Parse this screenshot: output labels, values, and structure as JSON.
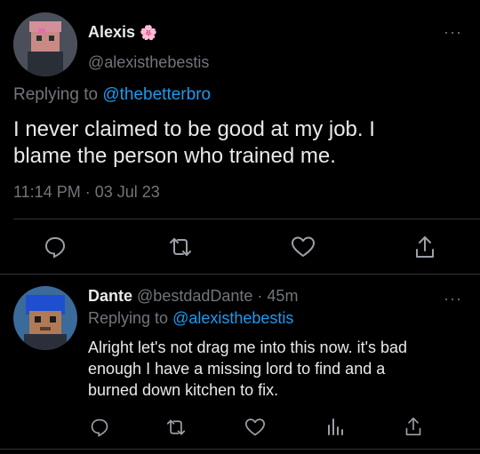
{
  "main_tweet": {
    "author_name": "Alexis",
    "badge_emoji": "🌸",
    "handle": "@alexisthebestis",
    "replying_prefix": "Replying to",
    "replying_handle": "@thebetterbro",
    "text_line1": "I never claimed to be good at my job. I",
    "text_line2": "blame the person who trained me.",
    "timestamp": "11:14 PM · 03 Jul 23",
    "more_label": "···"
  },
  "reply_tweet": {
    "author_name": "Dante",
    "handle": "@bestdadDante",
    "time_sep": "·",
    "time": "45m",
    "replying_prefix": "Replying to",
    "replying_handle": "@alexisthebestis",
    "text_line1": "Alright let's not drag me into this now. it's bad",
    "text_line2": "enough I have a missing lord to find and a",
    "text_line3": "burned down kitchen to fix.",
    "more_label": "···"
  },
  "colors": {
    "background": "#000000",
    "text": "#e7e9ea",
    "muted": "#71767b",
    "link": "#1d9bf0",
    "divider": "#2f3336"
  },
  "icons": {
    "main_actions": [
      "reply-icon",
      "retweet-icon",
      "like-icon",
      "share-icon"
    ],
    "reply_actions": [
      "reply-icon",
      "retweet-icon",
      "like-icon",
      "analytics-icon",
      "share-icon"
    ]
  }
}
